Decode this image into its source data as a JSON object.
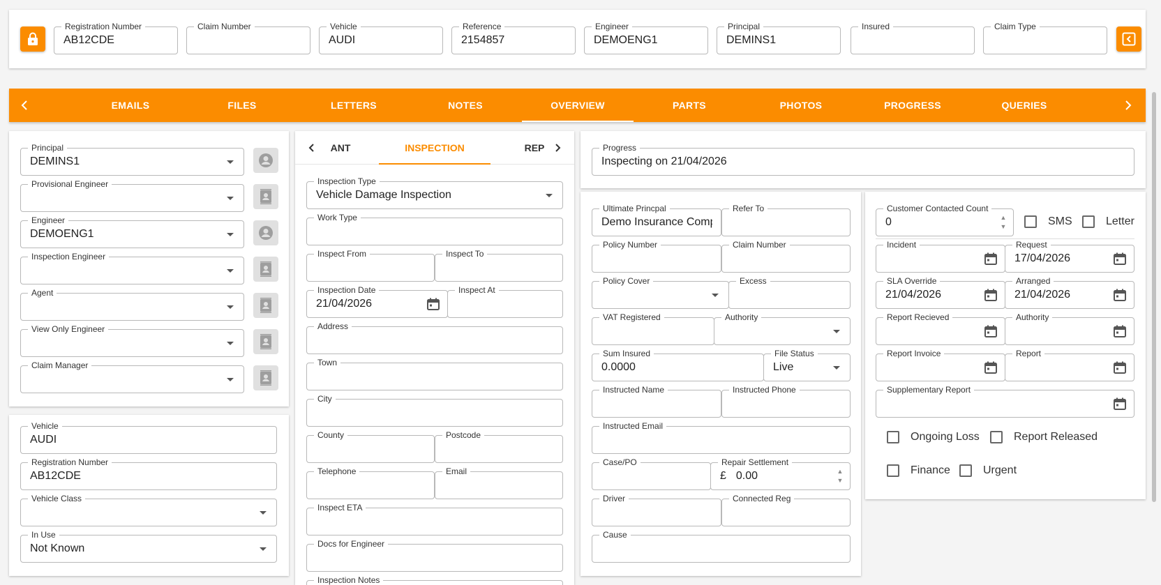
{
  "header": {
    "fields": [
      {
        "label": "Registration Number",
        "value": "AB12CDE"
      },
      {
        "label": "Claim Number",
        "value": ""
      },
      {
        "label": "Vehicle",
        "value": "AUDI"
      },
      {
        "label": "Reference",
        "value": "2154857"
      },
      {
        "label": "Engineer",
        "value": "DEMOENG1"
      },
      {
        "label": "Principal",
        "value": "DEMINS1"
      },
      {
        "label": "Insured",
        "value": ""
      },
      {
        "label": "Claim Type",
        "value": ""
      }
    ]
  },
  "tabs": [
    "EMAILS",
    "FILES",
    "LETTERS",
    "NOTES",
    "OVERVIEW",
    "PARTS",
    "PHOTOS",
    "PROGRESS",
    "QUERIES"
  ],
  "active_tab": "OVERVIEW",
  "contacts": {
    "principal": {
      "label": "Principal",
      "value": "DEMINS1"
    },
    "provisional_engineer": {
      "label": "Provisional Engineer",
      "value": ""
    },
    "engineer": {
      "label": "Engineer",
      "value": "DEMOENG1"
    },
    "inspection_engineer": {
      "label": "Inspection Engineer",
      "value": ""
    },
    "agent": {
      "label": "Agent",
      "value": ""
    },
    "view_only_engineer": {
      "label": "View Only Engineer",
      "value": ""
    },
    "claim_manager": {
      "label": "Claim Manager",
      "value": ""
    }
  },
  "vehicle_card": {
    "vehicle": {
      "label": "Vehicle",
      "value": "AUDI"
    },
    "registration": {
      "label": "Registration Number",
      "value": "AB12CDE"
    },
    "vehicle_class": {
      "label": "Vehicle Class",
      "value": ""
    },
    "in_use": {
      "label": "In Use",
      "value": "Not Known"
    }
  },
  "subtabs": {
    "left": "ANT",
    "active": "INSPECTION",
    "right": "REP"
  },
  "inspection": {
    "inspection_type": {
      "label": "Inspection Type",
      "value": "Vehicle Damage Inspection"
    },
    "work_type": {
      "label": "Work Type",
      "value": ""
    },
    "inspect_from": {
      "label": "Inspect From",
      "value": ""
    },
    "inspect_to": {
      "label": "Inspect To",
      "value": ""
    },
    "inspection_date": {
      "label": "Inspection Date",
      "value": "21/04/2026"
    },
    "inspect_at": {
      "label": "Inspect At",
      "value": ""
    },
    "address": {
      "label": "Address",
      "value": ""
    },
    "town": {
      "label": "Town",
      "value": ""
    },
    "city": {
      "label": "City",
      "value": ""
    },
    "county": {
      "label": "County",
      "value": ""
    },
    "postcode": {
      "label": "Postcode",
      "value": ""
    },
    "telephone": {
      "label": "Telephone",
      "value": ""
    },
    "email": {
      "label": "Email",
      "value": ""
    },
    "inspect_eta": {
      "label": "Inspect ETA",
      "value": ""
    },
    "docs_for_engineer": {
      "label": "Docs for Engineer",
      "value": ""
    },
    "inspection_notes": {
      "label": "Inspection Notes",
      "value": ""
    }
  },
  "progress": {
    "label": "Progress",
    "value": "Inspecting on 21/04/2026"
  },
  "policy": {
    "ultimate_principal": {
      "label": "Ultimate Princpal",
      "value": "Demo Insurance Company"
    },
    "refer_to": {
      "label": "Refer To",
      "value": ""
    },
    "policy_number": {
      "label": "Policy Number",
      "value": ""
    },
    "claim_number": {
      "label": "Claim Number",
      "value": ""
    },
    "policy_cover": {
      "label": "Policy Cover",
      "value": ""
    },
    "excess": {
      "label": "Excess",
      "value": ""
    },
    "vat_registered": {
      "label": "VAT Registered",
      "value": ""
    },
    "authority": {
      "label": "Authority",
      "value": ""
    },
    "sum_insured": {
      "label": "Sum Insured",
      "value": "0.0000"
    },
    "file_status": {
      "label": "File Status",
      "value": "Live"
    },
    "instructed_name": {
      "label": "Instructed Name",
      "value": ""
    },
    "instructed_phone": {
      "label": "Instructed Phone",
      "value": ""
    },
    "instructed_email": {
      "label": "Instructed Email",
      "value": ""
    },
    "case_po": {
      "label": "Case/PO",
      "value": ""
    },
    "repair_settlement": {
      "label": "Repair Settlement",
      "currency": "£",
      "value": "0.00"
    },
    "driver": {
      "label": "Driver",
      "value": ""
    },
    "connected_reg": {
      "label": "Connected Reg",
      "value": ""
    },
    "cause": {
      "label": "Cause",
      "value": ""
    }
  },
  "dates": {
    "customer_contacted_count": {
      "label": "Customer Contacted Count",
      "value": "0"
    },
    "sms": "SMS",
    "letter": "Letter",
    "incident": {
      "label": "Incident",
      "value": ""
    },
    "request": {
      "label": "Request",
      "value": "17/04/2026"
    },
    "sla_override": {
      "label": "SLA Override",
      "value": "21/04/2026"
    },
    "arranged": {
      "label": "Arranged",
      "value": "21/04/2026"
    },
    "report_recieved": {
      "label": "Report Recieved",
      "value": ""
    },
    "authority": {
      "label": "Authority",
      "value": ""
    },
    "report_invoice": {
      "label": "Report Invoice",
      "value": ""
    },
    "report": {
      "label": "Report",
      "value": ""
    },
    "supplementary_report": {
      "label": "Supplementary Report",
      "value": ""
    },
    "ongoing_loss": "Ongoing Loss",
    "report_released": "Report Released",
    "finance": "Finance",
    "urgent": "Urgent"
  },
  "colors": {
    "accent": "#fb8c00",
    "background": "#f4f4f4"
  }
}
